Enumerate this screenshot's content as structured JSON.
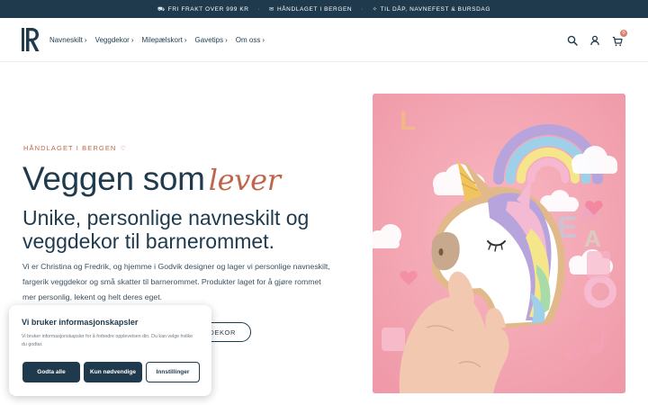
{
  "announcement": {
    "items": [
      {
        "icon": "truck-icon",
        "text": "FRI FRAKT OVER 999 KR"
      },
      {
        "icon": "gift-icon",
        "text": "HÅNDLAGET I BERGEN"
      },
      {
        "icon": "party-icon",
        "text": "TIL DÅP, NAVNEFEST & BURSDAG"
      }
    ]
  },
  "header": {
    "nav": [
      {
        "label": "Navneskilt"
      },
      {
        "label": "Veggdekor"
      },
      {
        "label": "Milepælskort"
      },
      {
        "label": "Gavetips"
      },
      {
        "label": "Om oss"
      }
    ],
    "cart_count": "0",
    "icons": [
      "search-icon",
      "account-icon",
      "cart-icon"
    ]
  },
  "hero": {
    "eyebrow": "HÅNDLAGET I BERGEN",
    "title_main": "Veggen som",
    "title_script": "lever",
    "subtitle": "Unike, personlige navneskilt og veggdekor til barnerommet.",
    "paragraph": "Vi er Christina og Fredrik, og hjemme i Godvik designer og lager vi personlige navneskilt, fargerik veggdekor og små skatter til barnerommet. Produkter laget for å gjøre rommet mer personlig, lekent og helt deres eget.",
    "cta_label": "DEKOR"
  },
  "cookie": {
    "title": "Vi bruker informasjonskapsler",
    "text": "Vi bruker informasjonskapsler for å forbedre opplevelsen din. Du kan velge hvilke du godtar.",
    "accept_all": "Godta alle",
    "necessary_only": "Kun nødvendige",
    "settings": "Innstillinger"
  },
  "colors": {
    "navy": "#1f3a4d",
    "accent": "#c0654a",
    "hero_bg": "#f4a3b0"
  }
}
